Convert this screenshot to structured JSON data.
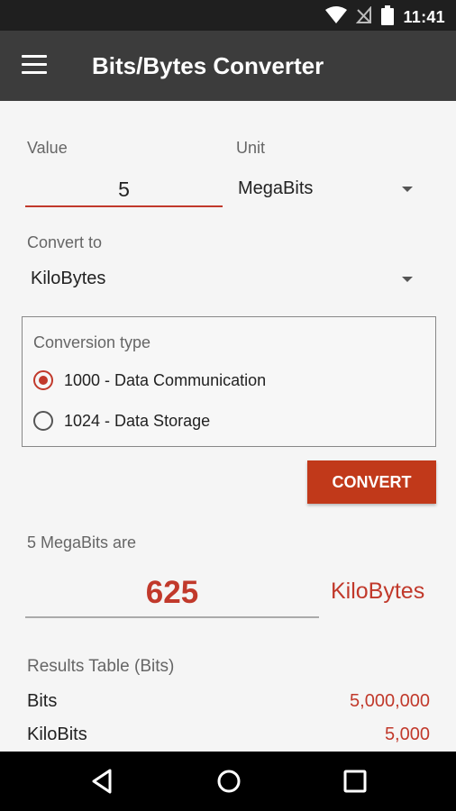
{
  "status_bar": {
    "time": "11:41"
  },
  "app_bar": {
    "title": "Bits/Bytes Converter",
    "menu_icon": "hamburger-menu-icon"
  },
  "form": {
    "value_label": "Value",
    "value": "5",
    "unit_label": "Unit",
    "unit_selected": "MegaBits",
    "convert_to_label": "Convert to",
    "convert_to_selected": "KiloBytes"
  },
  "conversion_type": {
    "title": "Conversion type",
    "options": [
      {
        "label": "1000 - Data Communication",
        "selected": true
      },
      {
        "label": "1024 - Data Storage",
        "selected": false
      }
    ]
  },
  "convert_button": {
    "label": "CONVERT"
  },
  "result": {
    "caption": "5 MegaBits are",
    "value": "625",
    "unit": "KiloBytes"
  },
  "results_table": {
    "title": "Results Table (Bits)",
    "rows": [
      {
        "name": "Bits",
        "value": "5,000,000"
      },
      {
        "name": "KiloBits",
        "value": "5,000"
      }
    ]
  },
  "colors": {
    "accent": "#c1392b",
    "app_bar": "#3c3c3c",
    "status_bar": "#1f1f1f",
    "nav_bar": "#000000"
  },
  "nav_bar": {
    "icons": [
      "back-icon",
      "home-icon",
      "recents-icon"
    ]
  }
}
